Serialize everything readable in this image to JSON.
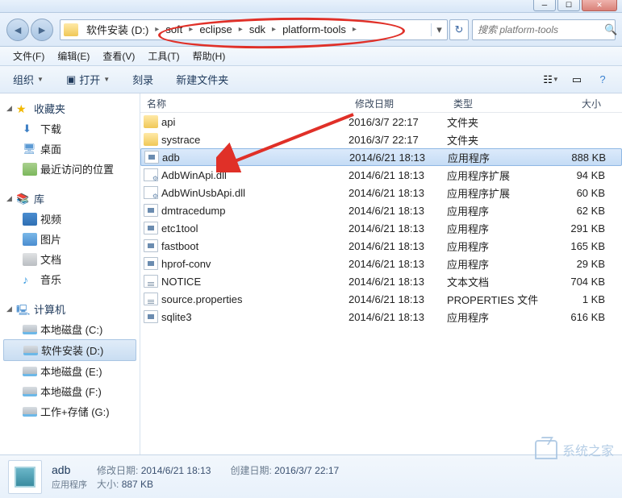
{
  "window": {
    "controls": {
      "min": "─",
      "max": "☐",
      "close": "✕"
    }
  },
  "breadcrumb": {
    "items": [
      "软件安装 (D:)",
      "soft",
      "eclipse",
      "sdk",
      "platform-tools"
    ],
    "dropdown_hint": "▾",
    "refresh_hint": "↻"
  },
  "search": {
    "placeholder": "搜索 platform-tools",
    "icon": "🔍"
  },
  "menu": {
    "items": [
      "文件(F)",
      "编辑(E)",
      "查看(V)",
      "工具(T)",
      "帮助(H)"
    ]
  },
  "toolbar": {
    "organize": "组织",
    "open": "打开",
    "burn": "刻录",
    "new_folder": "新建文件夹"
  },
  "sidebar": {
    "favorites": {
      "label": "收藏夹",
      "items": [
        "下载",
        "桌面",
        "最近访问的位置"
      ]
    },
    "libraries": {
      "label": "库",
      "items": [
        "视频",
        "图片",
        "文档",
        "音乐"
      ]
    },
    "computer": {
      "label": "计算机",
      "items": [
        "本地磁盘 (C:)",
        "软件安装 (D:)",
        "本地磁盘 (E:)",
        "本地磁盘 (F:)",
        "工作+存储 (G:)"
      ],
      "selected_index": 1
    }
  },
  "columns": {
    "name": "名称",
    "date": "修改日期",
    "type": "类型",
    "size": "大小"
  },
  "files": [
    {
      "name": "api",
      "date": "2016/3/7 22:17",
      "type": "文件夹",
      "size": "",
      "icon": "folder"
    },
    {
      "name": "systrace",
      "date": "2016/3/7 22:17",
      "type": "文件夹",
      "size": "",
      "icon": "folder"
    },
    {
      "name": "adb",
      "date": "2014/6/21 18:13",
      "type": "应用程序",
      "size": "888 KB",
      "icon": "exe",
      "selected": true
    },
    {
      "name": "AdbWinApi.dll",
      "date": "2014/6/21 18:13",
      "type": "应用程序扩展",
      "size": "94 KB",
      "icon": "dll"
    },
    {
      "name": "AdbWinUsbApi.dll",
      "date": "2014/6/21 18:13",
      "type": "应用程序扩展",
      "size": "60 KB",
      "icon": "dll"
    },
    {
      "name": "dmtracedump",
      "date": "2014/6/21 18:13",
      "type": "应用程序",
      "size": "62 KB",
      "icon": "exe"
    },
    {
      "name": "etc1tool",
      "date": "2014/6/21 18:13",
      "type": "应用程序",
      "size": "291 KB",
      "icon": "exe"
    },
    {
      "name": "fastboot",
      "date": "2014/6/21 18:13",
      "type": "应用程序",
      "size": "165 KB",
      "icon": "exe"
    },
    {
      "name": "hprof-conv",
      "date": "2014/6/21 18:13",
      "type": "应用程序",
      "size": "29 KB",
      "icon": "exe"
    },
    {
      "name": "NOTICE",
      "date": "2014/6/21 18:13",
      "type": "文本文档",
      "size": "704 KB",
      "icon": "txt"
    },
    {
      "name": "source.properties",
      "date": "2014/6/21 18:13",
      "type": "PROPERTIES 文件",
      "size": "1 KB",
      "icon": "txt"
    },
    {
      "name": "sqlite3",
      "date": "2014/6/21 18:13",
      "type": "应用程序",
      "size": "616 KB",
      "icon": "exe"
    }
  ],
  "details": {
    "name": "adb",
    "type": "应用程序",
    "modified_label": "修改日期:",
    "modified_value": "2014/6/21 18:13",
    "size_label": "大小:",
    "size_value": "887 KB",
    "created_label": "创建日期:",
    "created_value": "2016/3/7 22:17"
  },
  "watermark": "系统之家"
}
